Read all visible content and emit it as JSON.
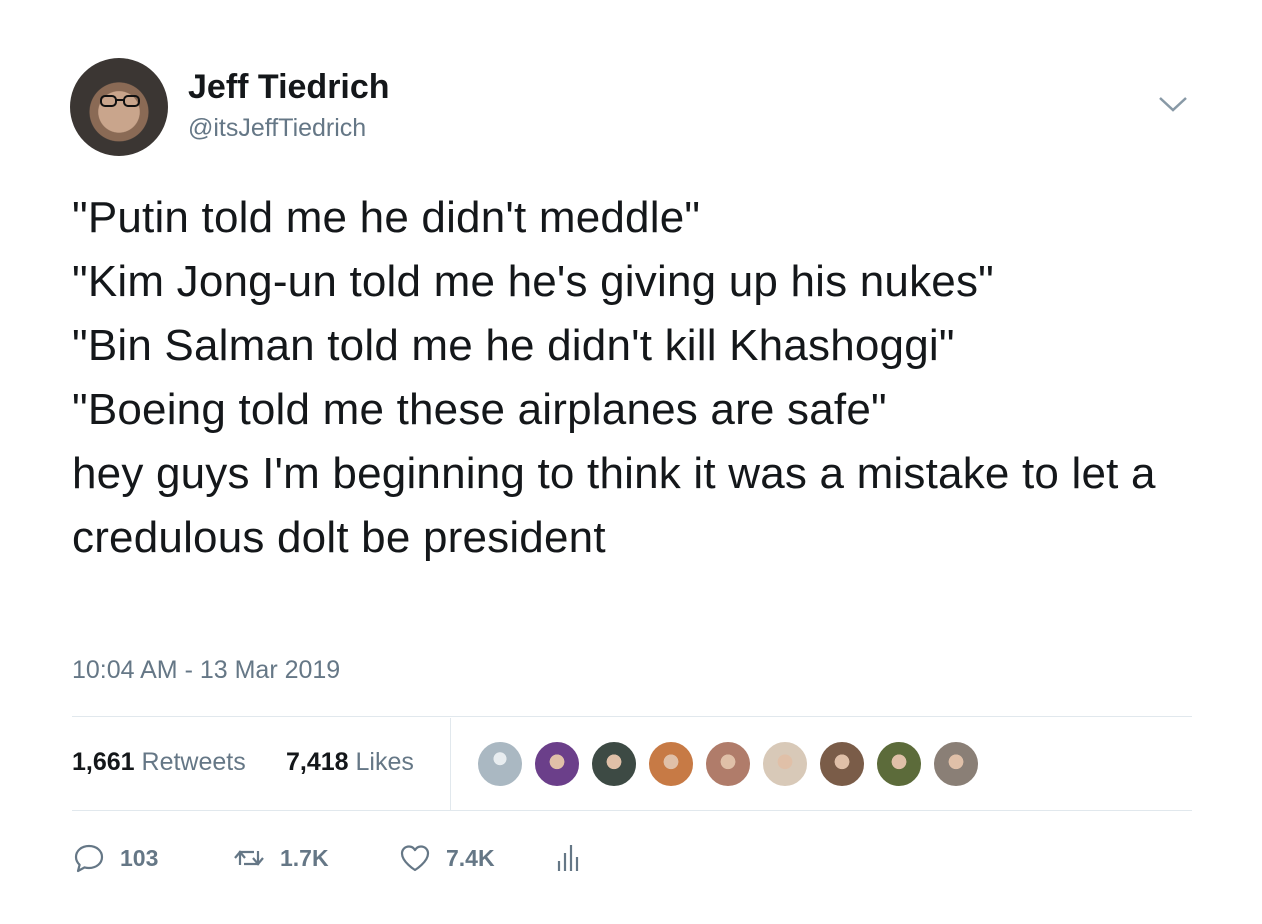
{
  "user": {
    "name": "Jeff Tiedrich",
    "handle": "@itsJeffTiedrich"
  },
  "tweet": {
    "text": "\"Putin told me he didn't meddle\"\n\"Kim Jong-un told me he's giving up his nukes\"\n\"Bin Salman told me he didn't kill Khashoggi\"\n\"Boeing told me these airplanes are safe\"\nhey guys I'm beginning to think it was a mistake to let a credulous dolt be president",
    "timestamp": "10:04 AM - 13 Mar 2019"
  },
  "stats": {
    "retweets_count": "1,661",
    "retweets_label": "Retweets",
    "likes_count": "7,418",
    "likes_label": "Likes"
  },
  "likers": [
    {
      "icon": "avatar-default",
      "color": "#aab8c2"
    },
    {
      "icon": "avatar-purple",
      "color": "#6b3f8a"
    },
    {
      "icon": "avatar-dark",
      "color": "#3d4a44"
    },
    {
      "icon": "avatar-woman",
      "color": "#c77a45"
    },
    {
      "icon": "avatar-glasses",
      "color": "#b07c6a"
    },
    {
      "icon": "avatar-figure",
      "color": "#d8c9b8"
    },
    {
      "icon": "avatar-brown",
      "color": "#7a5c48"
    },
    {
      "icon": "avatar-green",
      "color": "#5c6b3a"
    },
    {
      "icon": "avatar-man",
      "color": "#8a7f76"
    }
  ],
  "actions": {
    "replies": "103",
    "retweets": "1.7K",
    "likes": "7.4K"
  },
  "colors": {
    "text": "#14171a",
    "secondary": "#657786",
    "divider": "#e1e8ed"
  }
}
